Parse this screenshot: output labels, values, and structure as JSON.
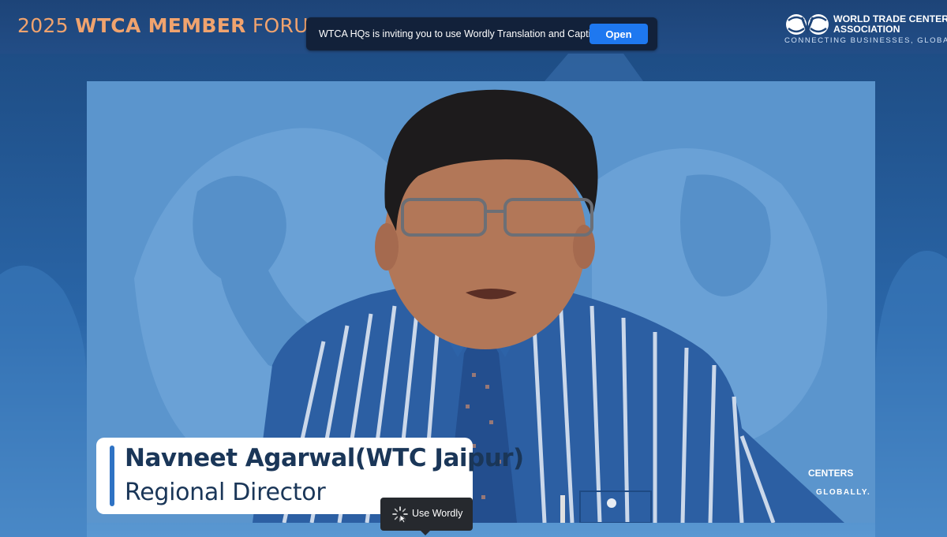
{
  "event_title": {
    "year": "2025",
    "brand": "WTCA MEMBER",
    "forum": "FORUM"
  },
  "wordly_banner": {
    "message": "WTCA HQs is inviting you to use Wordly Translation and Captions",
    "open_label": "Open"
  },
  "logo": {
    "line1": "WORLD TRADE CENTERS",
    "line2": "ASSOCIATION",
    "tagline": "CONNECTING BUSINESSES, GLOBALLY."
  },
  "speaker": {
    "name": "Navneet Agarwal(WTC Jaipur)",
    "role": "Regional Director"
  },
  "background_watermark": {
    "line1": "CENTERS",
    "line2": "GLOBALLY."
  },
  "wordly_tooltip": {
    "label": "Use Wordly"
  },
  "colors": {
    "accent_orange": "#f0a36e",
    "header_blue": "#1d4478",
    "open_button": "#1e78f0",
    "name_text": "#1a3658",
    "name_bar": "#2f73c4"
  }
}
